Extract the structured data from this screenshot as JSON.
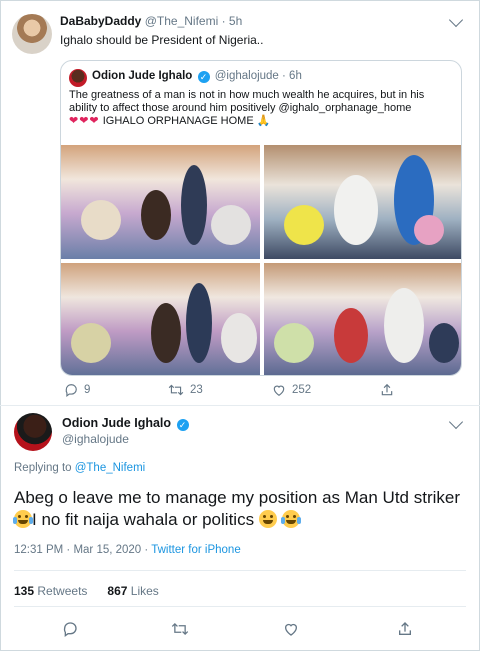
{
  "top_tweet": {
    "name": "DaBabyDaddy",
    "handle": "@The_Nifemi",
    "time": "· 5h",
    "text": "Ighalo should be President of Nigeria.."
  },
  "quoted": {
    "name": "Odion Jude Ighalo",
    "handle": "@ighalojude",
    "time": "· 6h",
    "text": "The greatness of a man is not in how much wealth he acquires, but in his ability to affect those around him positively @ighalo_orphanage_home",
    "hearts": "❤❤❤",
    "tail": " IGHALO ORPHANAGE HOME 🙏",
    "actions": {
      "replies": "9",
      "retweets": "23",
      "likes": "252"
    }
  },
  "reply": {
    "name": "Odion Jude Ighalo",
    "handle": "@ighalojude",
    "replying_prefix": "Replying to ",
    "replying_to": "@The_Nifemi",
    "text_part1": "Abeg o leave me to manage my position as Man Utd striker",
    "text_part2": "I no fit naija wahala or politics ",
    "meta": "12:31 PM · Mar 15, 2020 · ",
    "source": "Twitter for iPhone",
    "retweets_count": "135",
    "retweets_label": "Retweets",
    "likes_count": "867",
    "likes_label": "Likes"
  },
  "colors": {
    "accent": "#1da1f2",
    "link": "#1b95e0",
    "muted": "#657786",
    "heart": "#e0245e"
  },
  "icons": [
    "chevron-down-icon",
    "verified-icon",
    "reply-icon",
    "retweet-icon",
    "like-icon",
    "share-icon"
  ]
}
